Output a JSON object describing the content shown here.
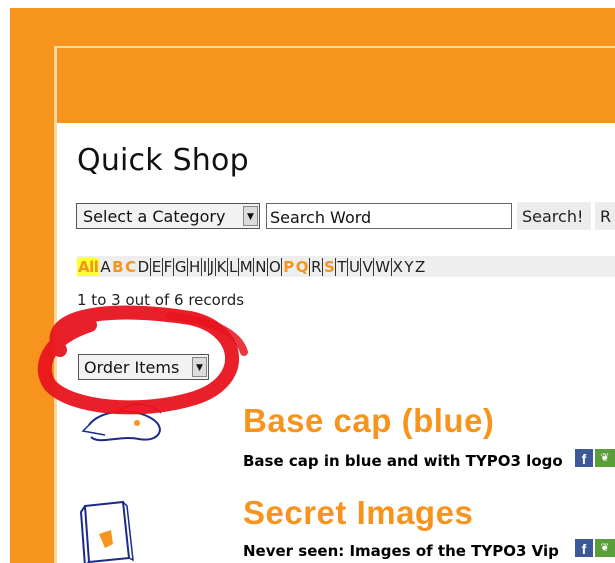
{
  "page": {
    "title": "Quick Shop",
    "colors": {
      "brand_orange": "#f7941d",
      "marker_red": "#e8141e",
      "facebook_blue": "#3b5998"
    }
  },
  "search": {
    "category_select_value": "Select a Category",
    "search_input_value": "Search Word",
    "search_button_label": "Search!",
    "reset_button_label": "R"
  },
  "alphabet": {
    "letters": [
      "All",
      "A",
      "B",
      "C",
      "D",
      "E",
      "F",
      "G",
      "H",
      "I",
      "J",
      "K",
      "L",
      "M",
      "N",
      "O",
      "P",
      "Q",
      "R",
      "S",
      "T",
      "U",
      "V",
      "W",
      "X",
      "Y",
      "Z"
    ],
    "highlighted": [
      "All"
    ],
    "bold_orange": [
      "B",
      "C",
      "P",
      "Q",
      "S"
    ]
  },
  "records": {
    "count_text": "1 to 3 out of 6 records"
  },
  "order": {
    "select_value": "Order Items"
  },
  "products": [
    {
      "name": "Base cap (blue)",
      "description": "Base cap in blue and with TYPO3 logo",
      "thumbnail": "cap-sketch-icon",
      "social": [
        "facebook-icon",
        "share-icon"
      ]
    },
    {
      "name": "Secret Images",
      "description": "Never seen: Images of the TYPO3 Vip",
      "thumbnail": "typo3-book-icon",
      "social": [
        "facebook-icon",
        "share-icon"
      ]
    }
  ]
}
